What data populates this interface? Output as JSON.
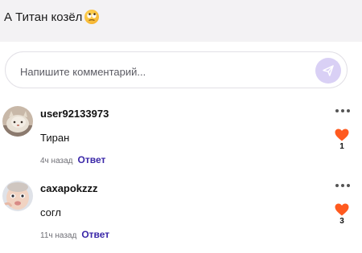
{
  "post": {
    "text": "А Титан козёл",
    "emoji": "eye-roll-emoji"
  },
  "composer": {
    "placeholder": "Напишите комментарий...",
    "value": "",
    "send_icon": "send-icon",
    "send_color": "#d9d0f5"
  },
  "comments": [
    {
      "username": "user92133973",
      "text": "Тиран",
      "time": "4ч назад",
      "reply_label": "Ответ",
      "likes": "1",
      "avatar": "cat-avatar"
    },
    {
      "username": "caxapokzzz",
      "text": "согл",
      "time": "11ч назад",
      "reply_label": "Ответ",
      "likes": "3",
      "avatar": "baby-avatar"
    }
  ],
  "colors": {
    "accent": "#3a27a8",
    "like": "#ff5a1f",
    "header_bg": "#f3f2f4"
  }
}
